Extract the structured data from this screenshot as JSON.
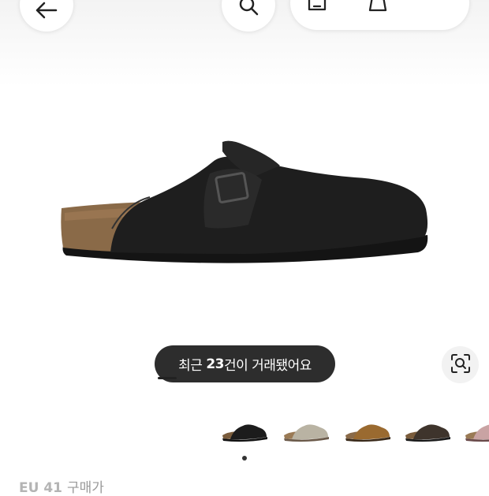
{
  "header": {
    "back_icon": "arrow-left-icon",
    "search_icon": "search-icon",
    "actions": [
      "share-icon",
      "bag-icon",
      "more-icon"
    ]
  },
  "product": {
    "image_alt": "black-suede-clog",
    "trade_badge": {
      "prefix": "최근 ",
      "count": "23",
      "suffix": "건이 거래됐어요"
    },
    "lens_icon": "image-search-icon",
    "thumbnails": [
      "black-clog",
      "taupe-clog",
      "brown-clog",
      "dark-brown-clog",
      "pink-clog"
    ],
    "page_indicator": {
      "current": 1
    }
  },
  "purchase": {
    "size_label": "EU 41",
    "price_label": "구매가"
  }
}
